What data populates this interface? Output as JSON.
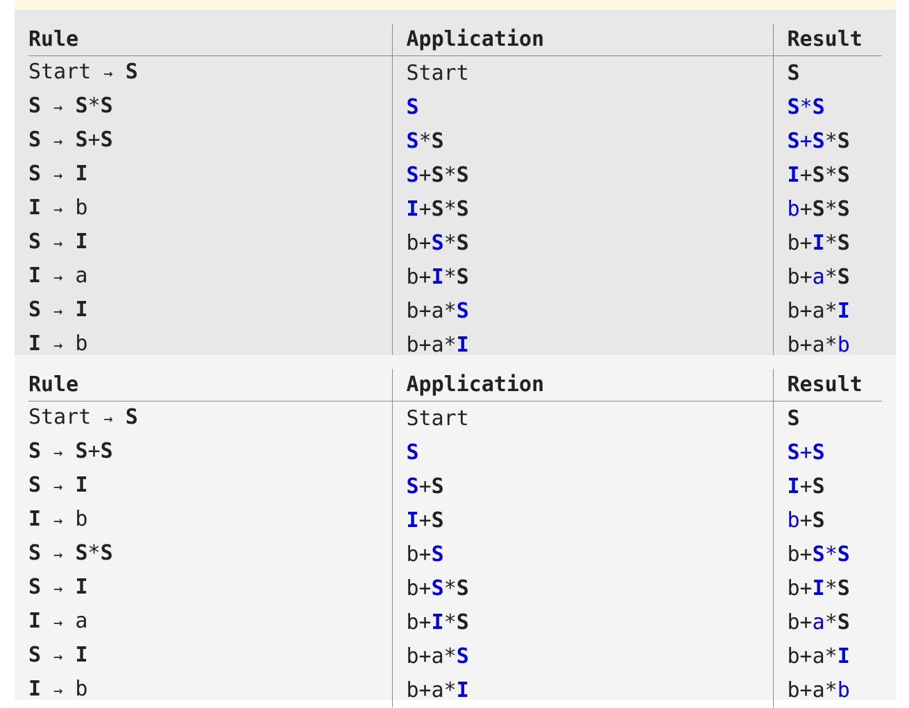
{
  "tables": [
    {
      "headers": {
        "rule": "Rule",
        "application": "Application",
        "result": "Result"
      },
      "rows": [
        {
          "rule": [
            {
              "t": "Start ",
              "b": false
            },
            {
              "t": "→",
              "b": false,
              "a": true
            },
            {
              "t": " ",
              "b": false
            },
            {
              "t": "S",
              "b": true
            }
          ],
          "app": [
            {
              "t": "Start",
              "b": false
            }
          ],
          "res": [
            {
              "t": "S",
              "b": true
            }
          ]
        },
        {
          "rule": [
            {
              "t": "S",
              "b": true
            },
            {
              "t": " ",
              "b": false
            },
            {
              "t": "→",
              "b": false,
              "a": true
            },
            {
              "t": " ",
              "b": false
            },
            {
              "t": "S",
              "b": true
            },
            {
              "t": "*",
              "b": false
            },
            {
              "t": "S",
              "b": true
            }
          ],
          "app": [
            {
              "t": "S",
              "b": true,
              "h": true
            }
          ],
          "res": [
            {
              "t": "S",
              "b": true,
              "h": true
            },
            {
              "t": "*",
              "b": false,
              "h": true
            },
            {
              "t": "S",
              "b": true,
              "h": true
            }
          ]
        },
        {
          "rule": [
            {
              "t": "S",
              "b": true
            },
            {
              "t": " ",
              "b": false
            },
            {
              "t": "→",
              "b": false,
              "a": true
            },
            {
              "t": " ",
              "b": false
            },
            {
              "t": "S",
              "b": true
            },
            {
              "t": "+",
              "b": false
            },
            {
              "t": "S",
              "b": true
            }
          ],
          "app": [
            {
              "t": "S",
              "b": true,
              "h": true
            },
            {
              "t": "*",
              "b": false
            },
            {
              "t": "S",
              "b": true
            }
          ],
          "res": [
            {
              "t": "S",
              "b": true,
              "h": true
            },
            {
              "t": "+",
              "b": false,
              "h": true
            },
            {
              "t": "S",
              "b": true,
              "h": true
            },
            {
              "t": "*",
              "b": false
            },
            {
              "t": "S",
              "b": true
            }
          ]
        },
        {
          "rule": [
            {
              "t": "S",
              "b": true
            },
            {
              "t": " ",
              "b": false
            },
            {
              "t": "→",
              "b": false,
              "a": true
            },
            {
              "t": " ",
              "b": false
            },
            {
              "t": "I",
              "b": true
            }
          ],
          "app": [
            {
              "t": "S",
              "b": true,
              "h": true
            },
            {
              "t": "+",
              "b": false
            },
            {
              "t": "S",
              "b": true
            },
            {
              "t": "*",
              "b": false
            },
            {
              "t": "S",
              "b": true
            }
          ],
          "res": [
            {
              "t": "I",
              "b": true,
              "h": true
            },
            {
              "t": "+",
              "b": false
            },
            {
              "t": "S",
              "b": true
            },
            {
              "t": "*",
              "b": false
            },
            {
              "t": "S",
              "b": true
            }
          ]
        },
        {
          "rule": [
            {
              "t": "I",
              "b": true
            },
            {
              "t": " ",
              "b": false
            },
            {
              "t": "→",
              "b": false,
              "a": true
            },
            {
              "t": " b",
              "b": false
            }
          ],
          "app": [
            {
              "t": "I",
              "b": true,
              "h": true
            },
            {
              "t": "+",
              "b": false
            },
            {
              "t": "S",
              "b": true
            },
            {
              "t": "*",
              "b": false
            },
            {
              "t": "S",
              "b": true
            }
          ],
          "res": [
            {
              "t": "b",
              "b": false,
              "h": true
            },
            {
              "t": "+",
              "b": false
            },
            {
              "t": "S",
              "b": true
            },
            {
              "t": "*",
              "b": false
            },
            {
              "t": "S",
              "b": true
            }
          ]
        },
        {
          "rule": [
            {
              "t": "S",
              "b": true
            },
            {
              "t": " ",
              "b": false
            },
            {
              "t": "→",
              "b": false,
              "a": true
            },
            {
              "t": " ",
              "b": false
            },
            {
              "t": "I",
              "b": true
            }
          ],
          "app": [
            {
              "t": "b+",
              "b": false
            },
            {
              "t": "S",
              "b": true,
              "h": true
            },
            {
              "t": "*",
              "b": false
            },
            {
              "t": "S",
              "b": true
            }
          ],
          "res": [
            {
              "t": "b+",
              "b": false
            },
            {
              "t": "I",
              "b": true,
              "h": true
            },
            {
              "t": "*",
              "b": false
            },
            {
              "t": "S",
              "b": true
            }
          ]
        },
        {
          "rule": [
            {
              "t": "I",
              "b": true
            },
            {
              "t": " ",
              "b": false
            },
            {
              "t": "→",
              "b": false,
              "a": true
            },
            {
              "t": " a",
              "b": false
            }
          ],
          "app": [
            {
              "t": "b+",
              "b": false
            },
            {
              "t": "I",
              "b": true,
              "h": true
            },
            {
              "t": "*",
              "b": false
            },
            {
              "t": "S",
              "b": true
            }
          ],
          "res": [
            {
              "t": "b+",
              "b": false
            },
            {
              "t": "a",
              "b": false,
              "h": true
            },
            {
              "t": "*",
              "b": false
            },
            {
              "t": "S",
              "b": true
            }
          ]
        },
        {
          "rule": [
            {
              "t": "S",
              "b": true
            },
            {
              "t": " ",
              "b": false
            },
            {
              "t": "→",
              "b": false,
              "a": true
            },
            {
              "t": " ",
              "b": false
            },
            {
              "t": "I",
              "b": true
            }
          ],
          "app": [
            {
              "t": "b+a*",
              "b": false
            },
            {
              "t": "S",
              "b": true,
              "h": true
            }
          ],
          "res": [
            {
              "t": "b+a*",
              "b": false
            },
            {
              "t": "I",
              "b": true,
              "h": true
            }
          ]
        },
        {
          "rule": [
            {
              "t": "I",
              "b": true
            },
            {
              "t": " ",
              "b": false
            },
            {
              "t": "→",
              "b": false,
              "a": true
            },
            {
              "t": " b",
              "b": false
            }
          ],
          "app": [
            {
              "t": "b+a*",
              "b": false
            },
            {
              "t": "I",
              "b": true,
              "h": true
            }
          ],
          "res": [
            {
              "t": "b+a*",
              "b": false
            },
            {
              "t": "b",
              "b": false,
              "h": true
            }
          ]
        }
      ]
    },
    {
      "headers": {
        "rule": "Rule",
        "application": "Application",
        "result": "Result"
      },
      "rows": [
        {
          "rule": [
            {
              "t": "Start ",
              "b": false
            },
            {
              "t": "→",
              "b": false,
              "a": true
            },
            {
              "t": " ",
              "b": false
            },
            {
              "t": "S",
              "b": true
            }
          ],
          "app": [
            {
              "t": "Start",
              "b": false
            }
          ],
          "res": [
            {
              "t": "S",
              "b": true
            }
          ]
        },
        {
          "rule": [
            {
              "t": "S",
              "b": true
            },
            {
              "t": " ",
              "b": false
            },
            {
              "t": "→",
              "b": false,
              "a": true
            },
            {
              "t": " ",
              "b": false
            },
            {
              "t": "S",
              "b": true
            },
            {
              "t": "+",
              "b": false
            },
            {
              "t": "S",
              "b": true
            }
          ],
          "app": [
            {
              "t": "S",
              "b": true,
              "h": true
            }
          ],
          "res": [
            {
              "t": "S",
              "b": true,
              "h": true
            },
            {
              "t": "+",
              "b": false,
              "h": true
            },
            {
              "t": "S",
              "b": true,
              "h": true
            }
          ]
        },
        {
          "rule": [
            {
              "t": "S",
              "b": true
            },
            {
              "t": " ",
              "b": false
            },
            {
              "t": "→",
              "b": false,
              "a": true
            },
            {
              "t": " ",
              "b": false
            },
            {
              "t": "I",
              "b": true
            }
          ],
          "app": [
            {
              "t": "S",
              "b": true,
              "h": true
            },
            {
              "t": "+",
              "b": false
            },
            {
              "t": "S",
              "b": true
            }
          ],
          "res": [
            {
              "t": "I",
              "b": true,
              "h": true
            },
            {
              "t": "+",
              "b": false
            },
            {
              "t": "S",
              "b": true
            }
          ]
        },
        {
          "rule": [
            {
              "t": "I",
              "b": true
            },
            {
              "t": " ",
              "b": false
            },
            {
              "t": "→",
              "b": false,
              "a": true
            },
            {
              "t": " b",
              "b": false
            }
          ],
          "app": [
            {
              "t": "I",
              "b": true,
              "h": true
            },
            {
              "t": "+",
              "b": false
            },
            {
              "t": "S",
              "b": true
            }
          ],
          "res": [
            {
              "t": "b",
              "b": false,
              "h": true
            },
            {
              "t": "+",
              "b": false
            },
            {
              "t": "S",
              "b": true
            }
          ]
        },
        {
          "rule": [
            {
              "t": "S",
              "b": true
            },
            {
              "t": " ",
              "b": false
            },
            {
              "t": "→",
              "b": false,
              "a": true
            },
            {
              "t": " ",
              "b": false
            },
            {
              "t": "S",
              "b": true
            },
            {
              "t": "*",
              "b": false
            },
            {
              "t": "S",
              "b": true
            }
          ],
          "app": [
            {
              "t": "b+",
              "b": false
            },
            {
              "t": "S",
              "b": true,
              "h": true
            }
          ],
          "res": [
            {
              "t": "b+",
              "b": false
            },
            {
              "t": "S",
              "b": true,
              "h": true
            },
            {
              "t": "*",
              "b": false,
              "h": true
            },
            {
              "t": "S",
              "b": true,
              "h": true
            }
          ]
        },
        {
          "rule": [
            {
              "t": "S",
              "b": true
            },
            {
              "t": " ",
              "b": false
            },
            {
              "t": "→",
              "b": false,
              "a": true
            },
            {
              "t": " ",
              "b": false
            },
            {
              "t": "I",
              "b": true
            }
          ],
          "app": [
            {
              "t": "b+",
              "b": false
            },
            {
              "t": "S",
              "b": true,
              "h": true
            },
            {
              "t": "*",
              "b": false
            },
            {
              "t": "S",
              "b": true
            }
          ],
          "res": [
            {
              "t": "b+",
              "b": false
            },
            {
              "t": "I",
              "b": true,
              "h": true
            },
            {
              "t": "*",
              "b": false
            },
            {
              "t": "S",
              "b": true
            }
          ]
        },
        {
          "rule": [
            {
              "t": "I",
              "b": true
            },
            {
              "t": " ",
              "b": false
            },
            {
              "t": "→",
              "b": false,
              "a": true
            },
            {
              "t": " a",
              "b": false
            }
          ],
          "app": [
            {
              "t": "b+",
              "b": false
            },
            {
              "t": "I",
              "b": true,
              "h": true
            },
            {
              "t": "*",
              "b": false
            },
            {
              "t": "S",
              "b": true
            }
          ],
          "res": [
            {
              "t": "b+",
              "b": false
            },
            {
              "t": "a",
              "b": false,
              "h": true
            },
            {
              "t": "*",
              "b": false
            },
            {
              "t": "S",
              "b": true
            }
          ]
        },
        {
          "rule": [
            {
              "t": "S",
              "b": true
            },
            {
              "t": " ",
              "b": false
            },
            {
              "t": "→",
              "b": false,
              "a": true
            },
            {
              "t": " ",
              "b": false
            },
            {
              "t": "I",
              "b": true
            }
          ],
          "app": [
            {
              "t": "b+a*",
              "b": false
            },
            {
              "t": "S",
              "b": true,
              "h": true
            }
          ],
          "res": [
            {
              "t": "b+a*",
              "b": false
            },
            {
              "t": "I",
              "b": true,
              "h": true
            }
          ]
        },
        {
          "rule": [
            {
              "t": "I",
              "b": true
            },
            {
              "t": " ",
              "b": false
            },
            {
              "t": "→",
              "b": false,
              "a": true
            },
            {
              "t": " b",
              "b": false
            }
          ],
          "app": [
            {
              "t": "b+a*",
              "b": false
            },
            {
              "t": "I",
              "b": true,
              "h": true
            }
          ],
          "res": [
            {
              "t": "b+a*",
              "b": false
            },
            {
              "t": "b",
              "b": false,
              "h": true
            }
          ]
        }
      ]
    }
  ],
  "colors": {
    "highlight": "#0000e0",
    "text": "#222222"
  }
}
